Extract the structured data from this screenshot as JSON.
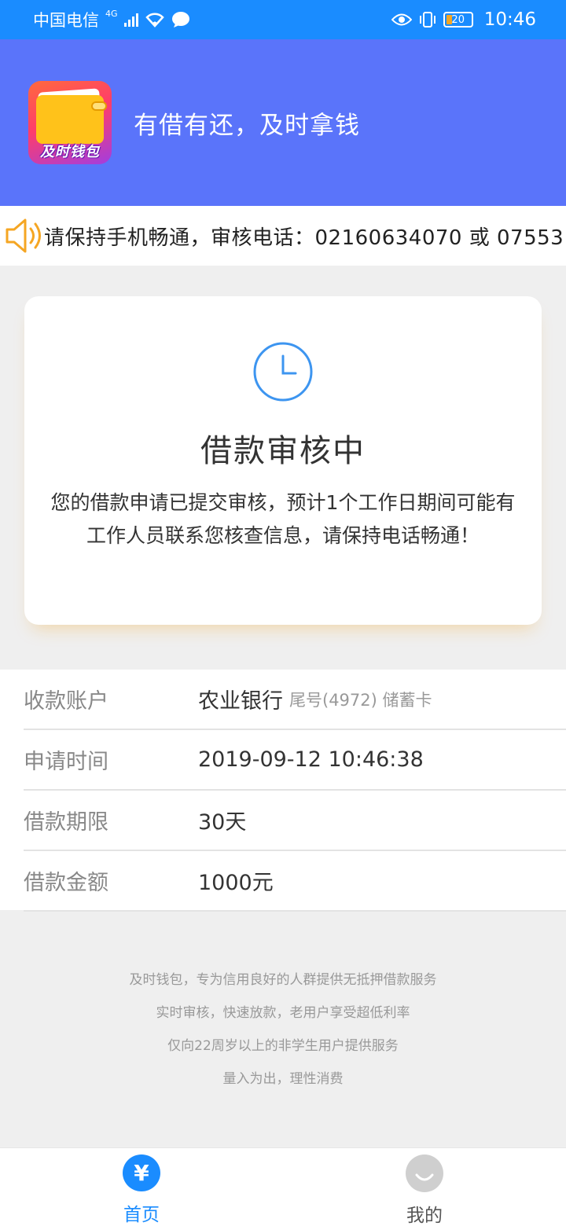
{
  "status_bar": {
    "carrier": "中国电信",
    "network": "4G",
    "battery": "20",
    "time": "10:46"
  },
  "header": {
    "logo_text": "及时钱包",
    "slogan": "有借有还，及时拿钱"
  },
  "notice": {
    "text": "请保持手机畅通，审核电话：02160634070 或 07553"
  },
  "status_card": {
    "title": "借款审核中",
    "message": "您的借款申请已提交审核，预计1个工作日期间可能有工作人员联系您核查信息，请保持电话畅通！"
  },
  "details": [
    {
      "label": "收款账户",
      "value": "农业银行",
      "sub": "尾号(4972) 储蓄卡"
    },
    {
      "label": "申请时间",
      "value": "2019-09-12 10:46:38",
      "sub": ""
    },
    {
      "label": "借款期限",
      "value": "30天",
      "sub": ""
    },
    {
      "label": "借款金额",
      "value": "1000元",
      "sub": ""
    }
  ],
  "footer_lines": [
    "及时钱包，专为信用良好的人群提供无抵押借款服务",
    "实时审核，快速放款，老用户享受超低利率",
    "仅向22周岁以上的非学生用户提供服务",
    "量入为出，理性消费"
  ],
  "bottom_nav": [
    {
      "label": "首页",
      "icon": "yen-icon",
      "active": true
    },
    {
      "label": "我的",
      "icon": "smile-icon",
      "active": false
    }
  ],
  "colors": {
    "status_bar": "#1a8cff",
    "header": "#5a74fa",
    "accent": "#1a8cff",
    "speaker": "#f5a623"
  }
}
